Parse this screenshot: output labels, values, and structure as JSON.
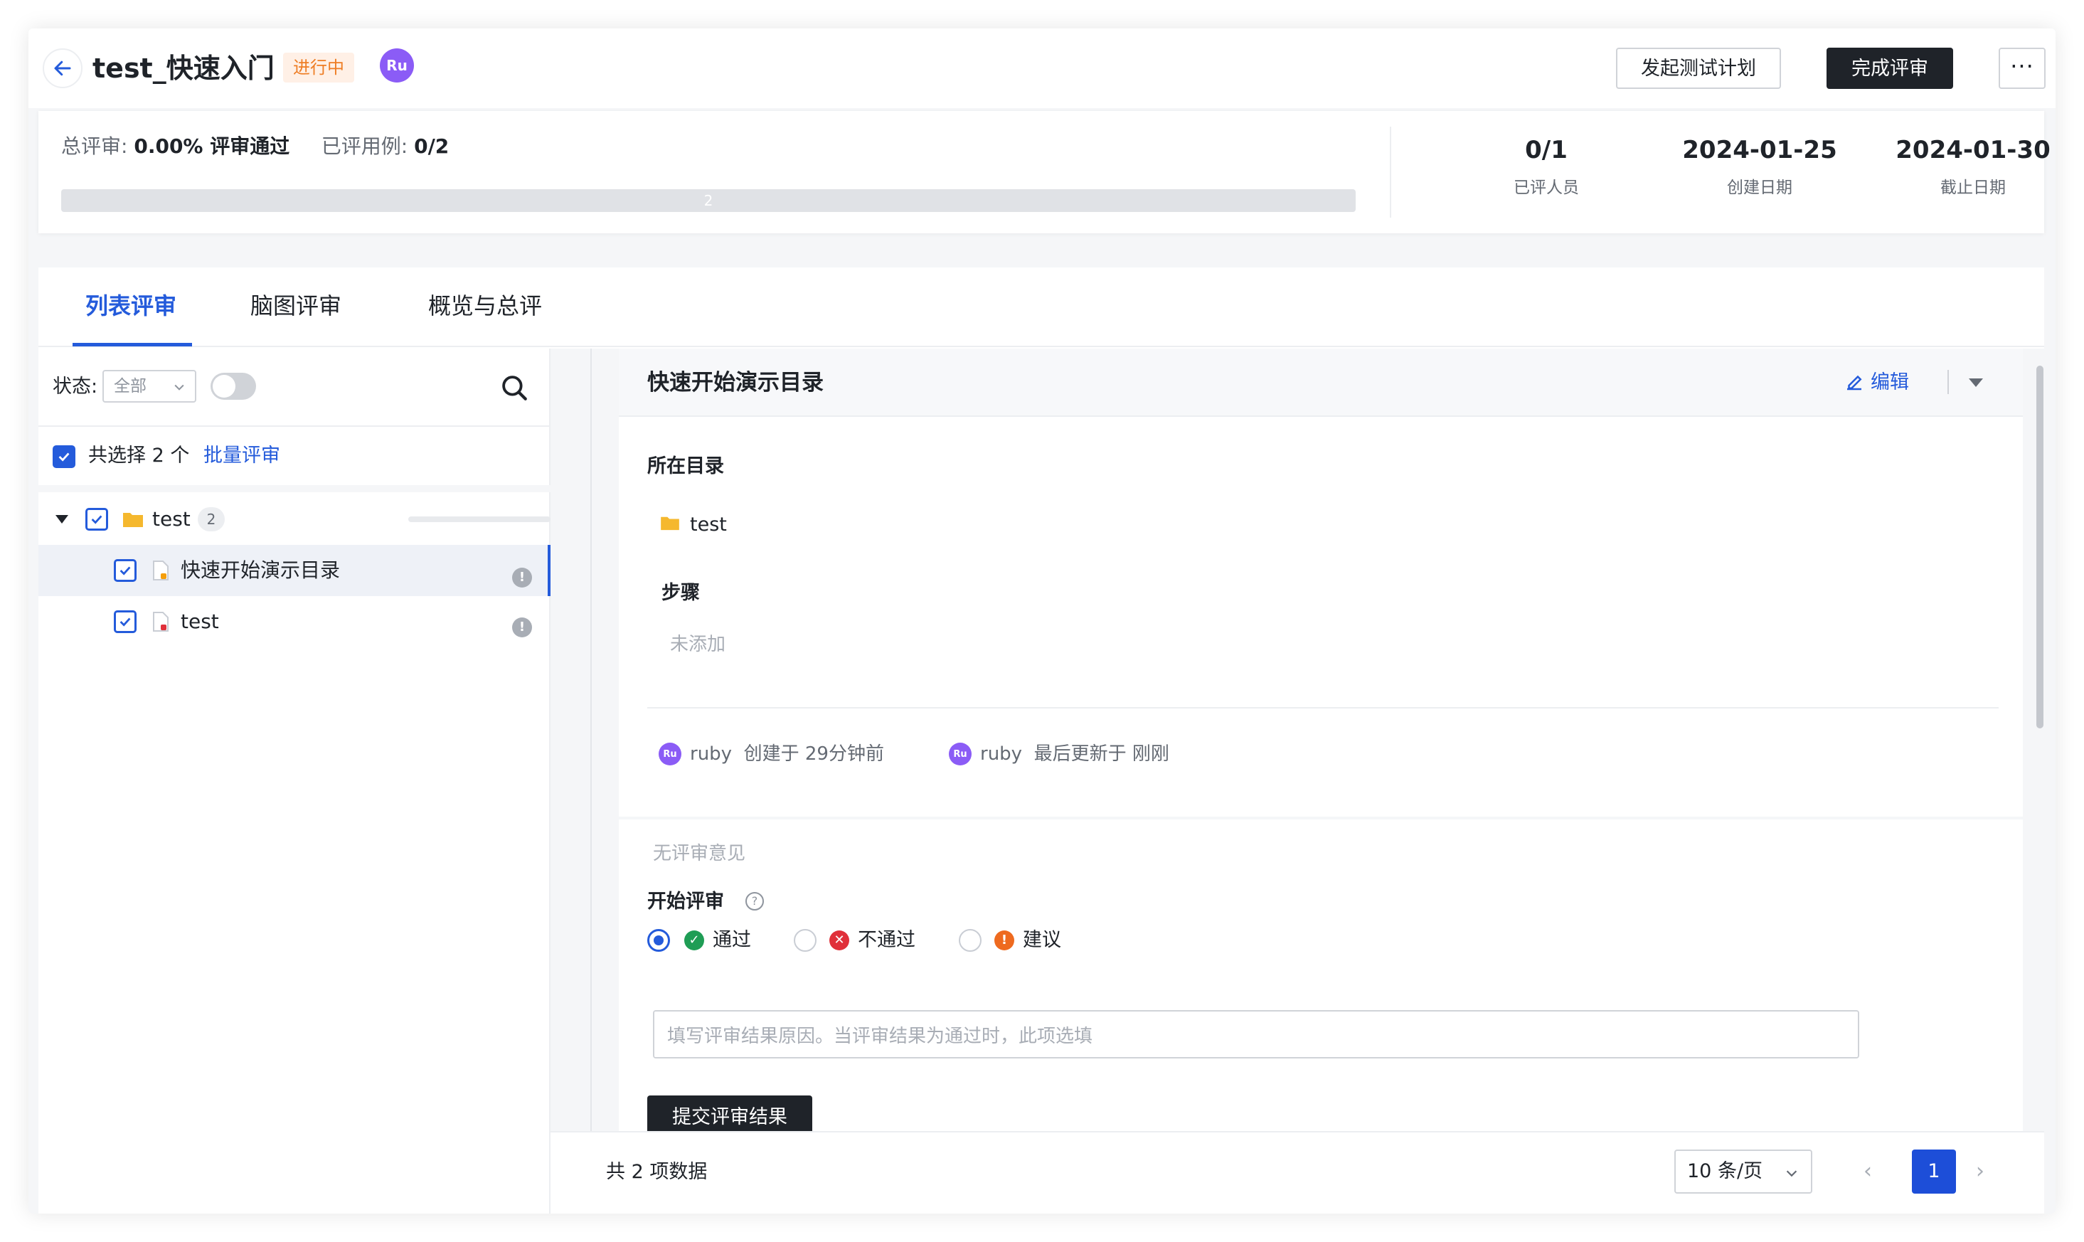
{
  "header": {
    "title": "test_快速入门",
    "status_badge": "进行中",
    "avatar_initials": "Ru",
    "start_plan_label": "发起测试计划",
    "complete_review_label": "完成评审",
    "more_label": "···"
  },
  "summary": {
    "total_review_label": "总评审:",
    "total_review_value": "0.00% 评审通过",
    "reviewed_cases_label": "已评用例:",
    "reviewed_cases_value": "0/2",
    "progress_text": "2",
    "progress_pass_fraction": 0.0,
    "stats": [
      {
        "value": "0/1",
        "caption": "已评人员"
      },
      {
        "value": "2024-01-25",
        "caption": "创建日期"
      },
      {
        "value": "2024-01-30",
        "caption": "截止日期"
      }
    ]
  },
  "tabs": [
    {
      "label": "列表评审",
      "active": true
    },
    {
      "label": "脑图评审",
      "active": false
    },
    {
      "label": "概览与总评",
      "active": false
    }
  ],
  "filter": {
    "status_label": "状态:",
    "status_value": "全部"
  },
  "selection": {
    "selected_text": "共选择 2 个",
    "batch_link": "批量评审"
  },
  "tree": {
    "folder": {
      "name": "test",
      "count": "2"
    },
    "items": [
      {
        "name": "快速开始演示目录",
        "selected": true,
        "info": "!"
      },
      {
        "name": "test",
        "selected": false,
        "info": "!"
      }
    ]
  },
  "detail": {
    "title": "快速开始演示目录",
    "edit_label": "编辑",
    "directory_label": "所在目录",
    "directory_value": "test",
    "steps_label": "步骤",
    "steps_value": "未添加",
    "created_avatar": "Ru",
    "created_user": "ruby",
    "created_text": "创建于 29分钟前",
    "updated_avatar": "Ru",
    "updated_user": "ruby",
    "updated_text": "最后更新于 刚刚",
    "no_comments": "无评审意见",
    "start_review_label": "开始评审",
    "help_glyph": "?",
    "options": [
      {
        "label": "通过",
        "checked": true,
        "color": "#1f9d55",
        "glyph": "✓"
      },
      {
        "label": "不通过",
        "checked": false,
        "color": "#e0303a",
        "glyph": "✕"
      },
      {
        "label": "建议",
        "checked": false,
        "color": "#ee6a1f",
        "glyph": "!"
      }
    ],
    "reason_placeholder": "填写评审结果原因。当评审结果为通过时，此项选填",
    "submit_label": "提交评审结果"
  },
  "pagination": {
    "total_text": "共 2 项数据",
    "page_size": "10 条/页",
    "prev": "‹",
    "next": "›",
    "current_page": "1"
  },
  "colors": {
    "accent": "#245bdb",
    "dark": "#1f2329",
    "badge_bg": "#fff0e6",
    "badge_fg": "#ee7d24",
    "avatar": "#8b5cf6",
    "folder": "#f5b82e"
  }
}
